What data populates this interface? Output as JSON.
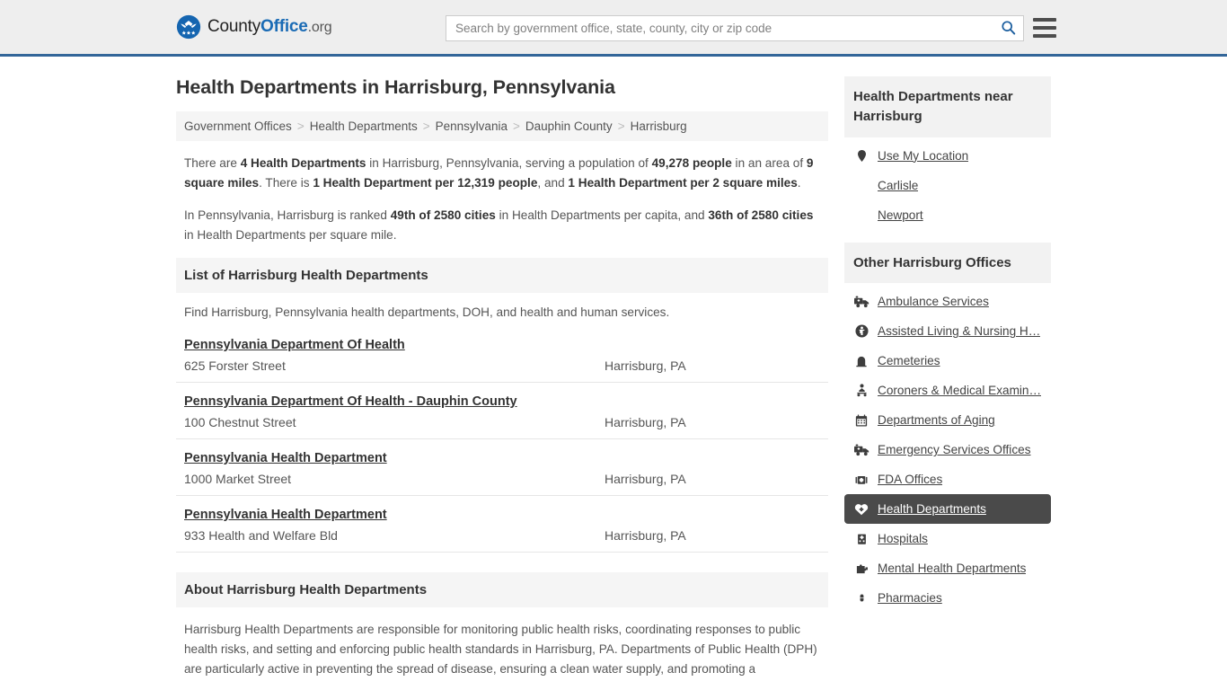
{
  "header": {
    "logo": {
      "emblem_icon": "eagle-seal-icon",
      "text_county": "County",
      "text_office": "Office",
      "text_org": ".org"
    },
    "search": {
      "placeholder": "Search by government office, state, county, city or zip code",
      "value": "",
      "search_icon": "search-icon"
    },
    "menu_icon": "hamburger-menu-icon",
    "accent_color": "#336699",
    "background_color": "#eeeeee"
  },
  "main": {
    "title": "Health Departments in Harrisburg, Pennsylvania",
    "breadcrumb": {
      "separator": ">",
      "items": [
        "Government Offices",
        "Health Departments",
        "Pennsylvania",
        "Dauphin County",
        "Harrisburg"
      ]
    },
    "intro": {
      "p1": [
        {
          "t": "There are ",
          "b": false
        },
        {
          "t": "4 Health Departments",
          "b": true
        },
        {
          "t": " in Harrisburg, Pennsylvania, serving a population of ",
          "b": false
        },
        {
          "t": "49,278 people",
          "b": true
        },
        {
          "t": " in an area of ",
          "b": false
        },
        {
          "t": "9 square miles",
          "b": true
        },
        {
          "t": ". There is ",
          "b": false
        },
        {
          "t": "1 Health Department per 12,319 people",
          "b": true
        },
        {
          "t": ", and ",
          "b": false
        },
        {
          "t": "1 Health Department per 2 square miles",
          "b": true
        },
        {
          "t": ".",
          "b": false
        }
      ],
      "p2": [
        {
          "t": "In Pennsylvania, Harrisburg is ranked ",
          "b": false
        },
        {
          "t": "49th of 2580 cities",
          "b": true
        },
        {
          "t": " in Health Departments per capita, and ",
          "b": false
        },
        {
          "t": "36th of 2580 cities",
          "b": true
        },
        {
          "t": " in Health Departments per square mile.",
          "b": false
        }
      ]
    },
    "list_section": {
      "heading": "List of Harrisburg Health Departments",
      "description": "Find Harrisburg, Pennsylvania health departments, DOH, and health and human services.",
      "listings": [
        {
          "name": "Pennsylvania Department Of Health",
          "address": "625 Forster Street",
          "city_state": "Harrisburg, PA"
        },
        {
          "name": "Pennsylvania Department Of Health - Dauphin County",
          "address": "100 Chestnut Street",
          "city_state": "Harrisburg, PA"
        },
        {
          "name": "Pennsylvania Health Department",
          "address": "1000 Market Street",
          "city_state": "Harrisburg, PA"
        },
        {
          "name": "Pennsylvania Health Department",
          "address": "933 Health and Welfare Bld",
          "city_state": "Harrisburg, PA"
        }
      ]
    },
    "about_section": {
      "heading": "About Harrisburg Health Departments",
      "body": "Harrisburg Health Departments are responsible for monitoring public health risks, coordinating responses to public health risks, and setting and enforcing public health standards in Harrisburg, PA. Departments of Public Health (DPH) are particularly active in preventing the spread of disease, ensuring a clean water supply, and promoting a"
    }
  },
  "sidebar": {
    "near_panel": {
      "heading": "Health Departments near Harrisburg",
      "items": [
        {
          "label": "Use My Location",
          "icon": "location-pin-icon",
          "has_icon": true
        },
        {
          "label": "Carlisle",
          "icon": "",
          "has_icon": false
        },
        {
          "label": "Newport",
          "icon": "",
          "has_icon": false
        }
      ]
    },
    "other_offices_panel": {
      "heading": "Other Harrisburg Offices",
      "active_background": "#4a4a4a",
      "items": [
        {
          "label": "Ambulance Services",
          "icon": "ambulance-icon",
          "active": false
        },
        {
          "label": "Assisted Living & Nursing H…",
          "icon": "accessibility-icon",
          "active": false
        },
        {
          "label": "Cemeteries",
          "icon": "gravestone-icon",
          "active": false
        },
        {
          "label": "Coroners & Medical Examin…",
          "icon": "coroner-icon",
          "active": false
        },
        {
          "label": "Departments of Aging",
          "icon": "calendar-icon",
          "active": false
        },
        {
          "label": "Emergency Services Offices",
          "icon": "ambulance-icon",
          "active": false
        },
        {
          "label": "FDA Offices",
          "icon": "medical-kit-icon",
          "active": false
        },
        {
          "label": "Health Departments",
          "icon": "heart-icon",
          "active": true
        },
        {
          "label": "Hospitals",
          "icon": "hospital-icon",
          "active": false
        },
        {
          "label": "Mental Health Departments",
          "icon": "puzzle-icon",
          "active": false
        },
        {
          "label": "Pharmacies",
          "icon": "pill-icon",
          "active": false
        }
      ]
    }
  }
}
